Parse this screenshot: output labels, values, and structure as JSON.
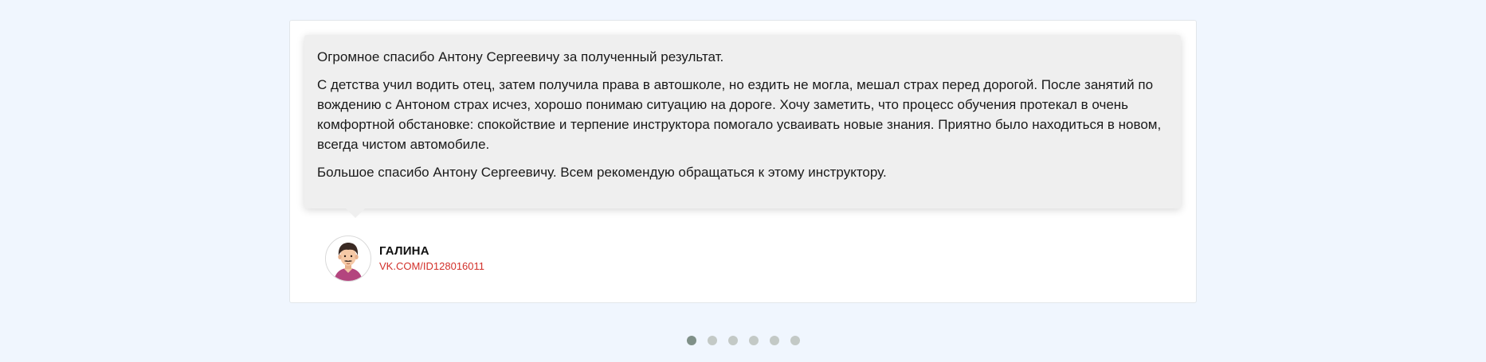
{
  "review": {
    "paragraphs": [
      "Огромное спасибо Антону Сергеевичу за полученный результат.",
      "С детства учил водить отец, затем получила права в автошколе, но ездить не могла, мешал страх перед дорогой. После занятий по вождению с Антоном страх исчез, хорошо понимаю ситуацию на дороге. Хочу заметить, что процесс обучения протекал в очень комфортной обстановке: спокойствие и терпение инструктора помогало усваивать новые знания. Приятно было находиться в новом, всегда чистом автомобиле.",
      "Большое спасибо Антону Сергеевичу. Всем рекомендую обращаться к этому инструктору."
    ],
    "author": {
      "name": "ГАЛИНА",
      "link": "VK.COM/ID128016011",
      "avatar_icon": "user-avatar-icon"
    }
  },
  "pagination": {
    "total": 6,
    "active_index": 0
  },
  "colors": {
    "background": "#f0f6fe",
    "quote_background": "#efefef",
    "link": "#d2302a",
    "dot_active": "#7f9088",
    "dot_inactive": "#c3c9c6"
  }
}
